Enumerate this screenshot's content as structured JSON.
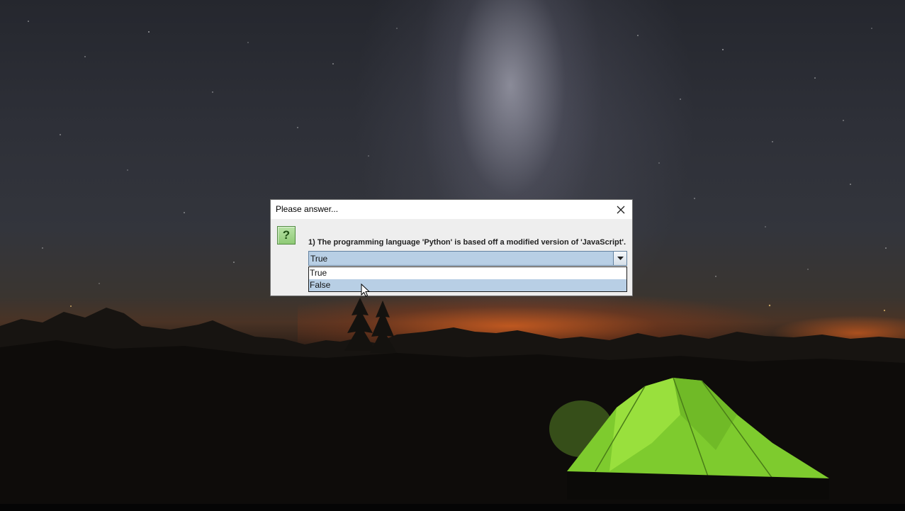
{
  "dialog": {
    "title": "Please answer...",
    "icon": "question-icon",
    "icon_glyph": "?",
    "question": "1) The programming language 'Python' is based off a modified version of 'JavaScript'.",
    "combo": {
      "selected": "True",
      "options": [
        "True",
        "False"
      ],
      "highlighted": "False"
    }
  },
  "colors": {
    "selection": "#b8cfe5",
    "combo_border": "#6382a0",
    "icon_green": "#8fca76"
  }
}
